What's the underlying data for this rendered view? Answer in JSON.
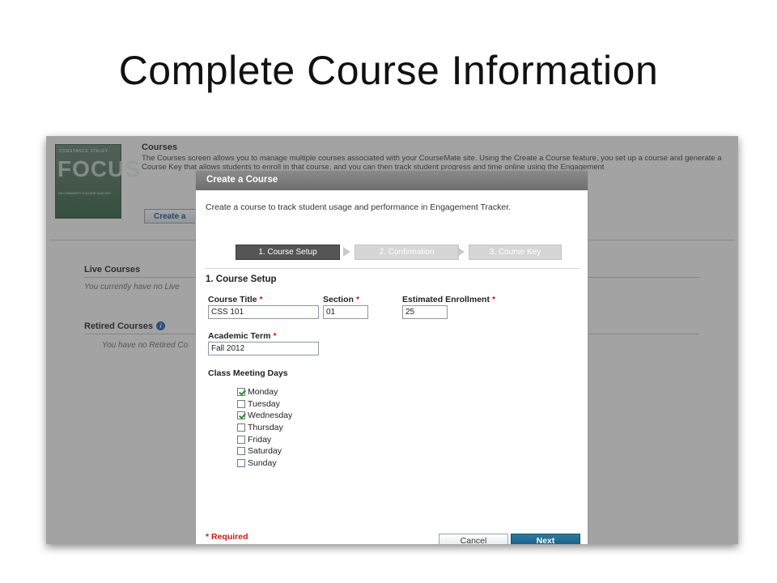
{
  "slide": {
    "title": "Complete Course Information"
  },
  "background": {
    "book": {
      "author": "CONSTANCE STALEY",
      "word": "FOCUS",
      "subtitle": "ON COMMUNITY COLLEGE SUCCESS"
    },
    "heading": "Courses",
    "description": "The Courses screen allows you to manage multiple courses associated with your CourseMate site. Using the Create a Course feature, you set up a course and generate a Course Key that allows students to enroll in that course, and you can then track student progress and time online using the Engagement",
    "create_button": "Create a",
    "live_courses": {
      "title": "Live Courses",
      "note": "You currently have no Live"
    },
    "retired_courses": {
      "title": "Retired Courses",
      "note": "You have no Retired Co"
    }
  },
  "modal": {
    "title": "Create a Course",
    "intro": "Create a course to track student usage and performance in Engagement Tracker.",
    "steps": [
      {
        "label": "1. Course Setup",
        "active": true
      },
      {
        "label": "2. Confirmation",
        "active": false
      },
      {
        "label": "3. Course Key",
        "active": false
      }
    ],
    "section_title": "1. Course Setup",
    "fields": {
      "course_title": {
        "label": "Course Title",
        "value": "CSS 101"
      },
      "section": {
        "label": "Section",
        "value": "01"
      },
      "estimated_enrollment": {
        "label": "Estimated Enrollment",
        "value": "25"
      },
      "academic_term": {
        "label": "Academic Term",
        "value": "Fall 2012"
      }
    },
    "required_star": "*",
    "meeting_days": {
      "label": "Class Meeting Days",
      "days": [
        {
          "name": "Monday",
          "checked": true
        },
        {
          "name": "Tuesday",
          "checked": false
        },
        {
          "name": "Wednesday",
          "checked": true
        },
        {
          "name": "Thursday",
          "checked": false
        },
        {
          "name": "Friday",
          "checked": false
        },
        {
          "name": "Saturday",
          "checked": false
        },
        {
          "name": "Sunday",
          "checked": false
        }
      ]
    },
    "required_note": "* Required",
    "cancel_label": "Cancel",
    "next_label": "Next"
  }
}
